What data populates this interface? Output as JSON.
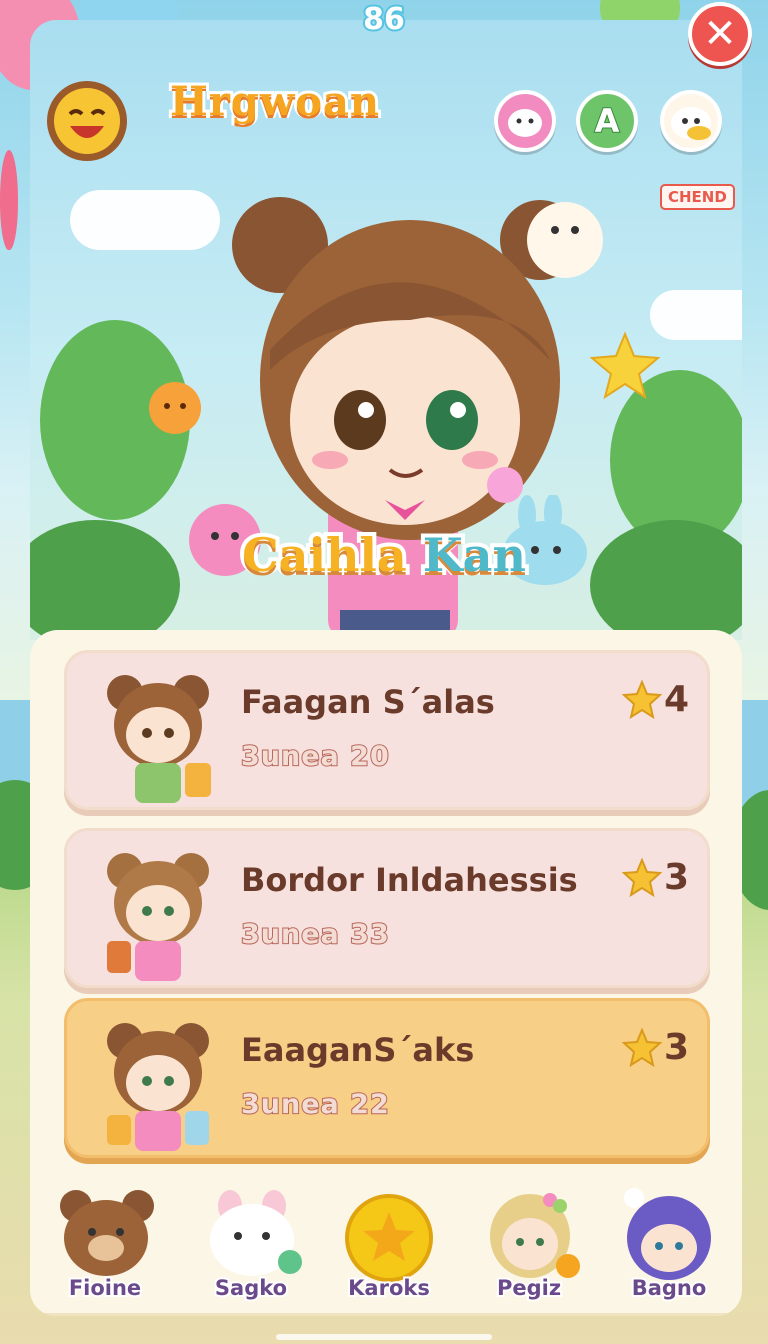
{
  "hud": {
    "score": "86"
  },
  "header": {
    "title": "Hrgwoan",
    "badge": "CHEND"
  },
  "character": {
    "name_part1": "Caihla",
    "name_part2": "Kan"
  },
  "cards": [
    {
      "title": "Faagan Sˊalas",
      "subtitle": "3unea 20",
      "stars": "4",
      "style": "pink"
    },
    {
      "title": "Bordor Inldahessis",
      "subtitle": "3unea 33",
      "stars": "3",
      "style": "pink"
    },
    {
      "title": "EaaganSˊaks",
      "subtitle": "3unea 22",
      "stars": "3",
      "style": "gold"
    }
  ],
  "tabs": [
    {
      "label": "Fioine",
      "icon": "bear-icon"
    },
    {
      "label": "Sagko",
      "icon": "bunny-icon"
    },
    {
      "label": "Karoks",
      "icon": "star-coin-icon"
    },
    {
      "label": "Pegiz",
      "icon": "girl-avatar-icon"
    },
    {
      "label": "Bagno",
      "icon": "purple-hair-avatar-icon"
    }
  ],
  "colors": {
    "accent": "#f5a51f",
    "close": "#ef5550",
    "card_pink": "#f7e1df",
    "card_gold": "#f8cf86"
  }
}
